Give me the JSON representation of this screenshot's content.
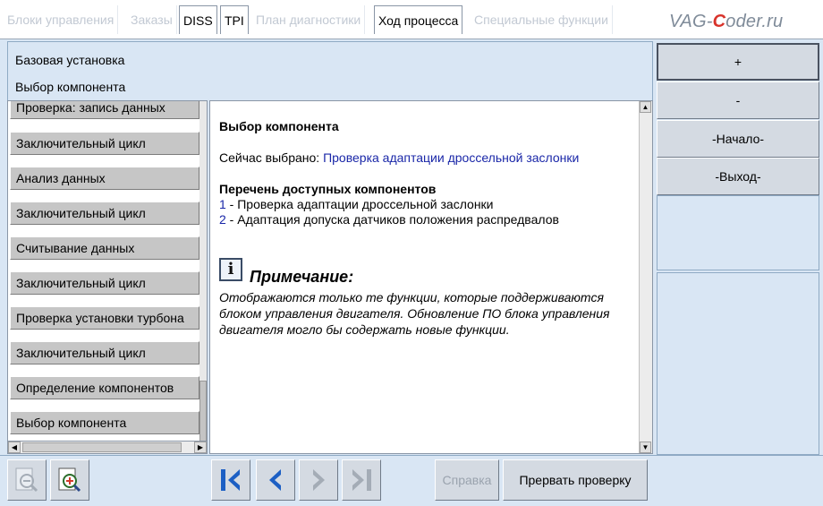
{
  "tabs": [
    {
      "label": "Блоки управления",
      "active": false
    },
    {
      "label": "Заказы",
      "active": false
    },
    {
      "label": "DISS",
      "active": true
    },
    {
      "label": "TPI",
      "active": true
    },
    {
      "label": "План диагностики",
      "active": false
    },
    {
      "label": "Ход процесса",
      "active": true
    },
    {
      "label": "Специальные функции",
      "active": false
    }
  ],
  "logo": {
    "part1": "VAG-",
    "part2": "C",
    "part3": "oder.ru"
  },
  "header": {
    "line1": "Базовая установка",
    "line2": "Выбор компонента"
  },
  "steps": [
    "Проверка: запись данных",
    "Заключительный цикл",
    "Анализ данных",
    "Заключительный цикл",
    "Считывание данных",
    "Заключительный цикл",
    "Проверка установки турбона",
    "Заключительный цикл",
    "Определение компонентов",
    "Выбор компонента"
  ],
  "content": {
    "title": "Выбор компонента",
    "selected_label": "Сейчас выбрано: ",
    "selected_value": "Проверка адаптации дроссельной заслонки",
    "list_heading": "Перечень доступных компонентов",
    "options": [
      {
        "num": "1",
        "text": " - Проверка адаптации дроссельной заслонки"
      },
      {
        "num": "2",
        "text": " - Адаптация допуска датчиков положения распредвалов"
      }
    ],
    "note_icon": "i",
    "note_title": "Примечание:",
    "note_text": "Отображаются только те функции, которые поддерживаются блоком управления двигателя. Обновление ПО блока управления двигателя могло бы содержать новые функции."
  },
  "right_buttons": {
    "plus": "+",
    "minus": "-",
    "start": "-Начало-",
    "exit": "-Выход-"
  },
  "bottom": {
    "help": "Справка",
    "abort": "Прервать проверку"
  },
  "icons": {
    "zoom_out": "zoom-out-icon",
    "zoom_in": "zoom-in-icon",
    "first": "skip-first-icon",
    "prev": "chevron-left-icon",
    "next": "chevron-right-icon",
    "last": "skip-last-icon"
  },
  "colors": {
    "accent": "#1a27a8",
    "nav_blue": "#1c5fc4",
    "panel": "#d9e6f4",
    "button": "#d4dae2"
  }
}
